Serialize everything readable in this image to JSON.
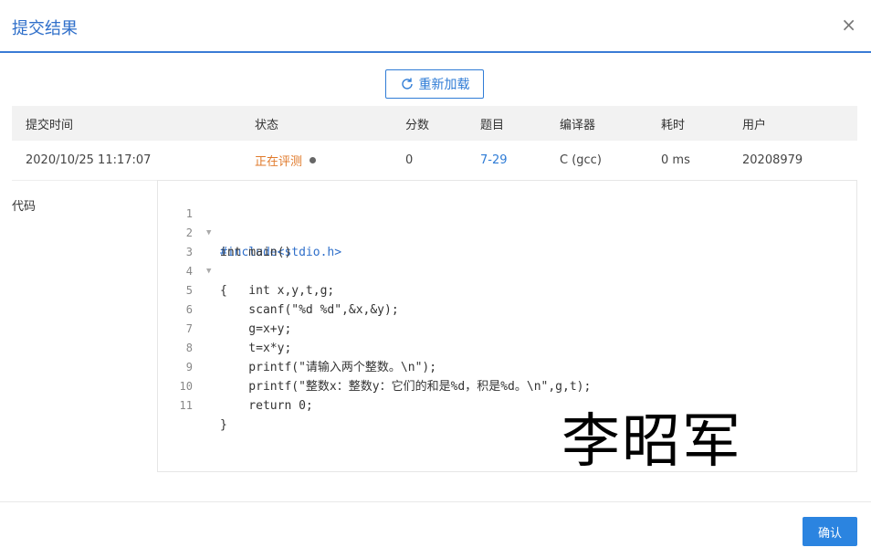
{
  "dialog": {
    "title": "提交结果",
    "close_glyph": "×"
  },
  "reload_label": "重新加载",
  "table": {
    "headers": [
      "提交时间",
      "状态",
      "分数",
      "题目",
      "编译器",
      "耗时",
      "用户"
    ],
    "row": {
      "time": "2020/10/25 11:17:07",
      "status": "正在评测",
      "score": "0",
      "problem": "7-29",
      "compiler": "C (gcc)",
      "duration": "0 ms",
      "user": "20208979"
    }
  },
  "code_label": "代码",
  "code": {
    "line_numbers": [
      "1",
      "2",
      "3",
      "4",
      "5",
      "6",
      "7",
      "8",
      "9",
      "10",
      "11"
    ],
    "lines": [
      "#include<stdio.h>",
      "int main()",
      "{",
      "    int x,y,t,g;",
      "    scanf(\"%d %d\",&x,&y);",
      "    g=x+y;",
      "    t=x*y;",
      "    printf(\"请输入两个整数。\\n\");",
      "    printf(\"整数x：整数y：它们的和是%d，积是%d。\\n\",g,t);",
      "    return 0;",
      "}"
    ]
  },
  "signature_text": "李昭军",
  "confirm_label": "确认",
  "colors": {
    "accent": "#2f7cd6",
    "status": "#e07a2b",
    "header_bg": "#f2f2f2"
  }
}
